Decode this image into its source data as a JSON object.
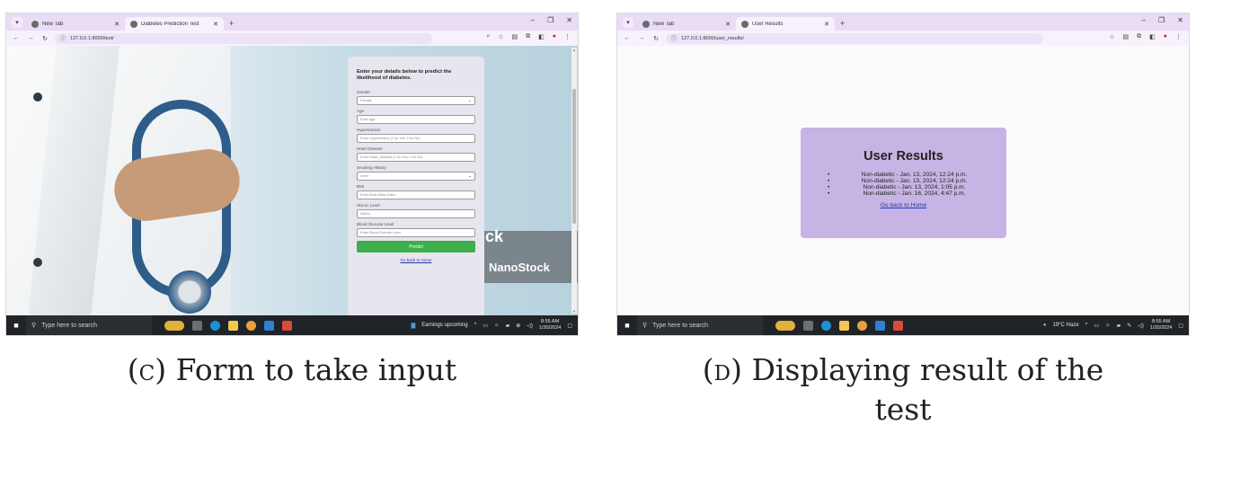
{
  "panel_c": {
    "tabs": [
      {
        "label": "New Tab",
        "active": false
      },
      {
        "label": "Diabetes Prediction Test",
        "active": true
      }
    ],
    "url": "127.0.0.1:8000/test/",
    "form": {
      "heading": "Enter your details below to predict the likelihood of diabetes.",
      "fields": [
        {
          "label": "Gender",
          "value": "Female",
          "type": "select"
        },
        {
          "label": "Age",
          "value": "Enter age",
          "type": "input"
        },
        {
          "label": "Hypertension",
          "value": "Enter Hypertension (1 for Yes, 0 for No)",
          "type": "input"
        },
        {
          "label": "Heart Disease",
          "value": "Enter Heart_Disease (1 for Yes, 0 for No)",
          "type": "input"
        },
        {
          "label": "Smoking History",
          "value": "never",
          "type": "select"
        },
        {
          "label": "BMI",
          "value": "Enter Body Mass Index",
          "type": "input"
        },
        {
          "label": "HbA1c Level",
          "value": "HbA1c",
          "type": "input"
        },
        {
          "label": "Blood Glucose Level",
          "value": "Enter Blood Glucose Level",
          "type": "input"
        }
      ],
      "submit_label": "Predict",
      "home_link": "Go back to Home"
    },
    "watermark": {
      "top": "ck",
      "bottom": "NanoStock"
    },
    "taskbar": {
      "search_placeholder": "Type here to search",
      "news": "Earnings upcoming",
      "time": "8:55 AM",
      "date": "1/20/2024"
    },
    "caption": {
      "letter": "(c)",
      "text": "Form to take input"
    }
  },
  "panel_d": {
    "tabs": [
      {
        "label": "New Tab",
        "active": false
      },
      {
        "label": "User Results",
        "active": true
      }
    ],
    "url": "127.0.0.1:8000/user_results/",
    "results": {
      "title": "User Results",
      "items": [
        "Non-diabetic - Jan. 13, 2024, 12:24 p.m.",
        "Non-diabetic - Jan. 13, 2024, 12:24 p.m.",
        "Non-diabetic - Jan. 13, 2024, 1:05 p.m.",
        "Non-diabetic - Jan. 16, 2024, 4:47 p.m."
      ],
      "home_link": "Go back to Home"
    },
    "taskbar": {
      "search_placeholder": "Type here to search",
      "weather": "19°C Haze",
      "time": "8:55 AM",
      "date": "1/20/2024"
    },
    "caption": {
      "letter": "(d)",
      "text": "Displaying result of the",
      "text_line2": "test"
    }
  }
}
